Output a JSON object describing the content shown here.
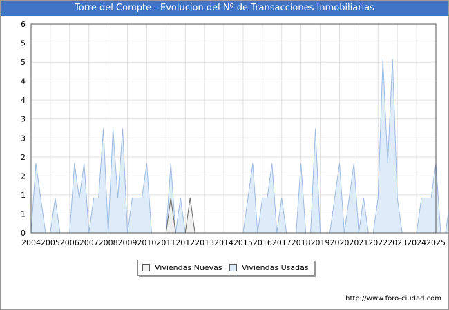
{
  "title": "Torre del Compte - Evolucion del Nº de Transacciones Inmobiliarias",
  "footer_url": "http://www.foro-ciudad.com",
  "chart_data": {
    "type": "area",
    "title": "Torre del Compte - Evolucion del Nº de Transacciones Inmobiliarias",
    "xlabel": "",
    "ylabel": "",
    "xlim": [
      2004,
      2025
    ],
    "ylim": [
      0,
      6
    ],
    "x_ticks": [
      "2004",
      "2005",
      "2006",
      "2007",
      "2008",
      "2009",
      "2010",
      "2011",
      "2012",
      "2013",
      "2014",
      "2015",
      "2016",
      "2017",
      "2018",
      "2019",
      "2020",
      "2021",
      "2022",
      "2023",
      "2024",
      "2025"
    ],
    "y_ticks": [
      "0",
      "1",
      "1",
      "2",
      "2",
      "3",
      "3",
      "4",
      "4",
      "5",
      "5",
      "6"
    ],
    "x_step": 0.25,
    "grid": true,
    "legend_position": "bottom-center",
    "series": [
      {
        "name": "Viviendas Nuevas",
        "color": "#f0f0f0",
        "stroke": "#666666",
        "values": [
          0,
          0,
          0,
          0,
          0,
          0,
          0,
          0,
          0,
          0,
          0,
          0,
          0,
          0,
          0,
          0,
          0,
          0,
          0,
          0,
          0,
          0,
          0,
          0,
          0,
          0,
          0,
          0,
          0,
          1,
          0,
          0,
          0,
          1,
          0,
          0,
          0,
          0,
          0,
          0,
          0,
          0,
          0,
          0,
          0,
          0,
          0,
          0,
          0,
          0,
          0,
          0,
          0,
          0,
          0,
          0,
          0,
          0,
          0,
          0,
          0,
          0,
          0,
          0,
          0,
          0,
          0,
          0,
          0,
          0,
          0,
          0,
          0,
          0,
          0,
          0,
          0,
          0,
          0,
          0,
          0,
          0,
          0,
          0,
          0,
          0,
          0,
          0,
          0
        ]
      },
      {
        "name": "Viviendas Usadas",
        "color": "#deebf9",
        "stroke": "#9dbbe0",
        "values": [
          0,
          2,
          1,
          0,
          0,
          1,
          0,
          0,
          0,
          2,
          1,
          2,
          0,
          1,
          1,
          3,
          0,
          3,
          1,
          3,
          0,
          1,
          1,
          1,
          2,
          0,
          0,
          0,
          0,
          2,
          0,
          1,
          0,
          0,
          0,
          0,
          0,
          0,
          0,
          0,
          0,
          0,
          0,
          0,
          0,
          1,
          2,
          0,
          1,
          1,
          2,
          0,
          1,
          0,
          0,
          0,
          2,
          0,
          0,
          3,
          0,
          0,
          0,
          1,
          2,
          0,
          1,
          2,
          0,
          1,
          0,
          0,
          1,
          5,
          2,
          5,
          1,
          0,
          0,
          0,
          0,
          1,
          1,
          1,
          2,
          0,
          0,
          1,
          0,
          1,
          0,
          0,
          0
        ]
      }
    ]
  }
}
